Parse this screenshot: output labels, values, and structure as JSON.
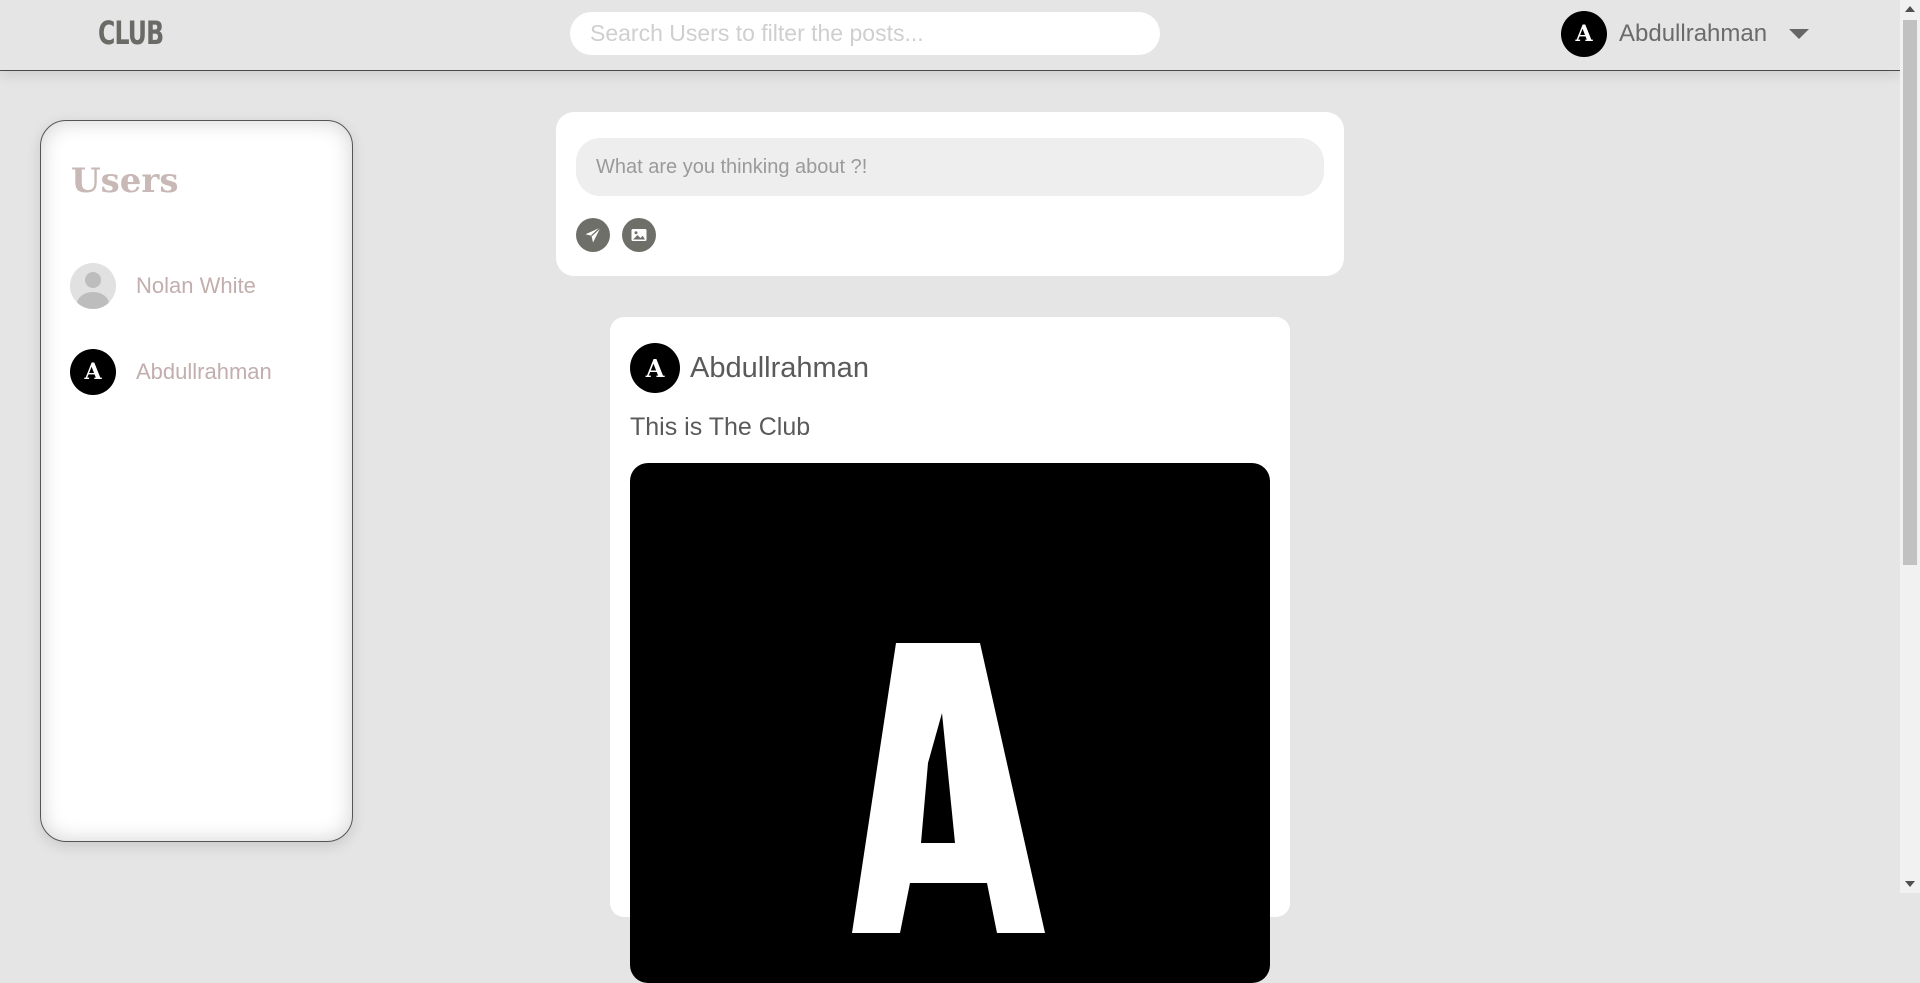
{
  "header": {
    "logo": "CLUB",
    "search_placeholder": "Search Users to filter the posts...",
    "current_user": {
      "initial": "A",
      "name": "Abdullrahman"
    }
  },
  "sidebar": {
    "title": "Users",
    "users": [
      {
        "name": "Nolan White",
        "avatar": "default-avatar"
      },
      {
        "name": "Abdullrahman",
        "avatar": "initial",
        "initial": "A"
      }
    ]
  },
  "composer": {
    "placeholder": "What are you thinking about ?!",
    "send_icon": "paper-plane-icon",
    "image_icon": "image-icon"
  },
  "posts": [
    {
      "author": "Abdullrahman",
      "author_initial": "A",
      "text": "This is The Club",
      "image_letter": "A"
    }
  ],
  "colors": {
    "background": "#e5e5e5",
    "card": "#ffffff",
    "accent_text": "#c2aeac",
    "icon_button": "#6f6f6a",
    "avatar": "#000000"
  }
}
